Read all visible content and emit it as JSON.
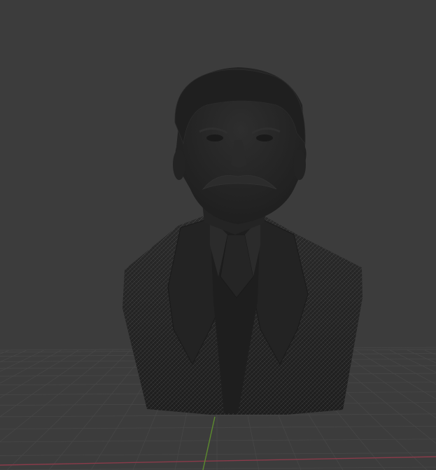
{
  "viewport": {
    "mode": "3d-viewport",
    "shading": "solid-wireframe",
    "background_color": "#3c3c3c",
    "grid_line_color": "#474747",
    "axis_x_color": "#8a3b4a",
    "axis_y_color": "#5c8a2e"
  },
  "model": {
    "object": "bust-mesh",
    "mesh_color": "#262626",
    "wire_color": "#9a9a9a"
  }
}
